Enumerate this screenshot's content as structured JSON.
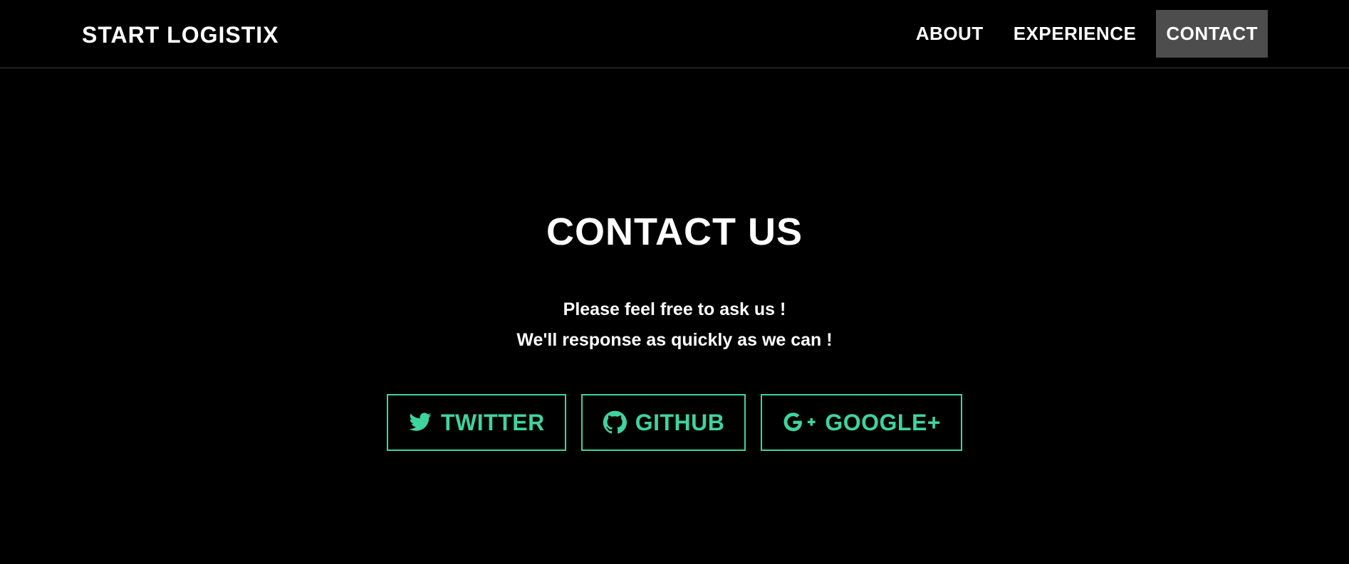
{
  "brand": "START LOGISTIX",
  "nav": [
    {
      "label": "ABOUT"
    },
    {
      "label": "EXPERIENCE"
    },
    {
      "label": "CONTACT",
      "active": true
    }
  ],
  "contact": {
    "title": "CONTACT US",
    "line1": "Please feel free to ask us !",
    "line2": "We'll response as quickly as we can !"
  },
  "social": [
    {
      "label": "TWITTER",
      "icon": "twitter-icon"
    },
    {
      "label": "GITHUB",
      "icon": "github-icon"
    },
    {
      "label": "GOOGLE+",
      "icon": "google-plus-icon"
    }
  ],
  "colors": {
    "background": "#000000",
    "accent": "#3fd3a0",
    "active_nav": "#4d4d4d",
    "text": "#ffffff"
  }
}
